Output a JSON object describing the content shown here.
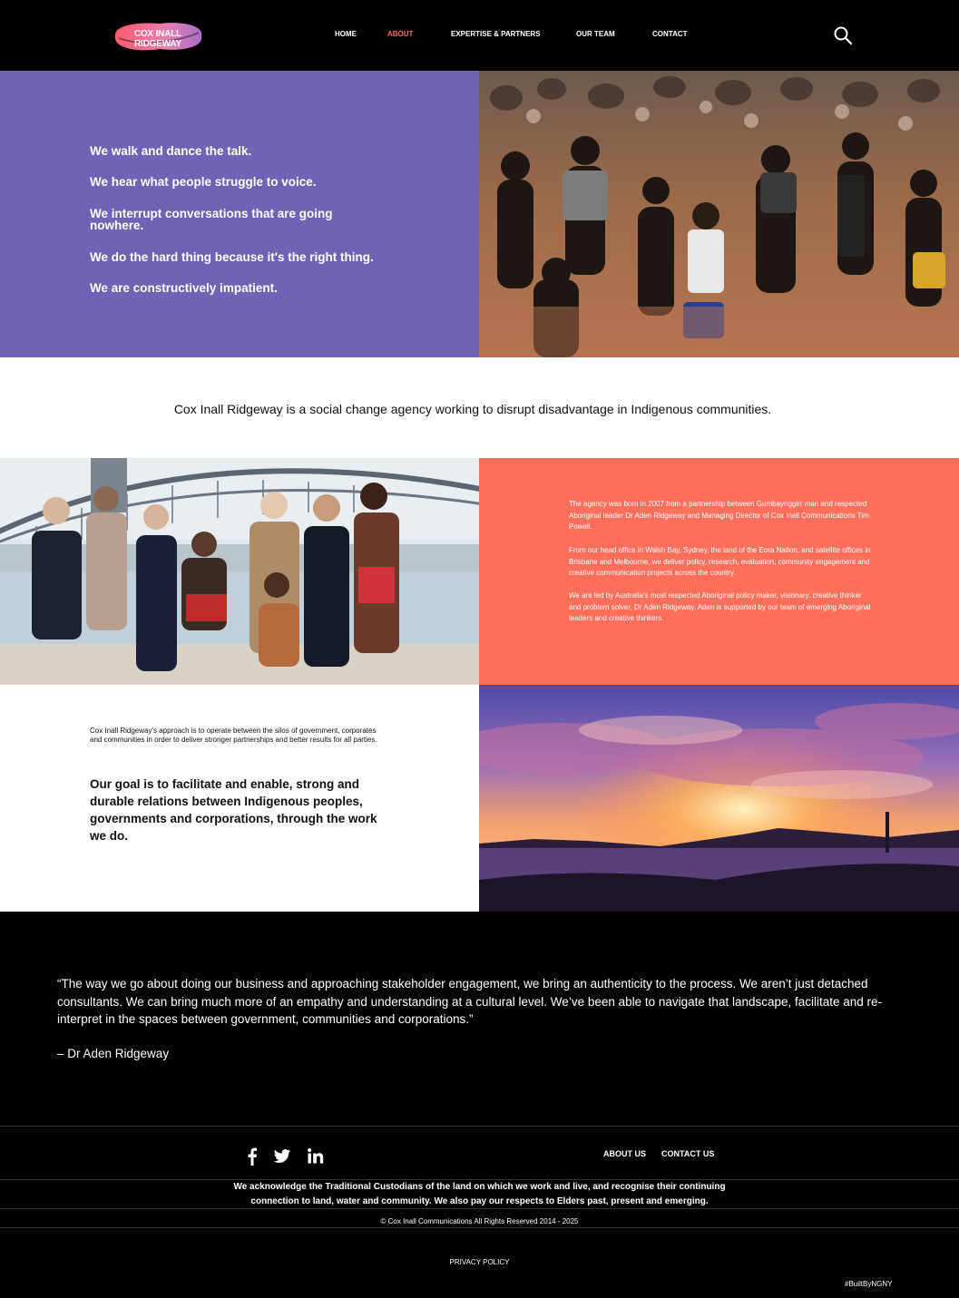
{
  "header": {
    "logo_text": "COX INALL RIDGEWAY",
    "nav": [
      {
        "label": "HOME",
        "active": false
      },
      {
        "label": "ABOUT",
        "active": true
      },
      {
        "label": "EXPERTISE & PARTNERS",
        "active": false
      },
      {
        "label": "OUR TEAM",
        "active": false
      },
      {
        "label": "CONTACT",
        "active": false
      }
    ],
    "search_icon": "search-icon"
  },
  "hero": {
    "lines": [
      "We walk and dance the talk.",
      "We hear what people struggle to voice.",
      "We interrupt conversations that are going nowhere.",
      "We do the hard thing because it's the right thing.",
      "We are constructively impatient."
    ]
  },
  "statement": "Cox Inall Ridgeway is a social change agency working to disrupt disadvantage in Indigenous communities.",
  "about": {
    "paragraphs": [
      "The agency was born in 2007 from a partnership between Gumbaynggirr man and respected Aboriginal leader Dr Aden Ridgeway and Managing Director of Cox Inall Communications Tim Powell.",
      "From our head office in Walsh Bay, Sydney, the land of the Eora Nation, and satellite offices in Brisbane and Melbourne, we deliver policy, research, evaluation, community engagement and creative communication projects across the country.",
      "We are led by Australia's most respected Aboriginal policy maker, visionary, creative thinker and problem solver, Dr Aden Ridgeway. Aden is supported by our team of emerging Aboriginal leaders and creative thinkers."
    ]
  },
  "approach": {
    "small": "Cox Inall Ridgeway's approach is to operate between the silos of government, corporates and communities in order to deliver stronger partnerships and better results for all parties.",
    "goal": "Our goal is to facilitate and enable, strong and durable relations between Indigenous peoples, governments and corporations, through the work we do."
  },
  "quote": {
    "text": "“The way we go about doing our business and approaching stakeholder engagement, we bring an authenticity to the process. We aren’t just detached consultants. We can bring much more of an empathy and understanding at a cultural level. We’ve been able to navigate that landscape, facilitate and re-interpret in the spaces between government, communities and corporations.”",
    "author": "– Dr Aden Ridgeway"
  },
  "footer": {
    "social": [
      "facebook-icon",
      "twitter-icon",
      "linkedin-icon"
    ],
    "links": [
      "ABOUT US",
      "CONTACT US"
    ],
    "acknowledgement": "We acknowledge the Traditional Custodians of the land on which we work and live, and recognise their continuing connection to land, water and community. We also pay our respects to Elders past, present and emerging.",
    "copyright": "© Cox Inall Communications All Rights Reserved 2014 - 2025",
    "privacy": "PRIVACY POLICY",
    "built_by": "#BuiltByNGNY"
  },
  "colors": {
    "purple": "#6e63b5",
    "coral": "#ff6f5c",
    "active_nav": "#ff6b55",
    "black": "#000000"
  }
}
